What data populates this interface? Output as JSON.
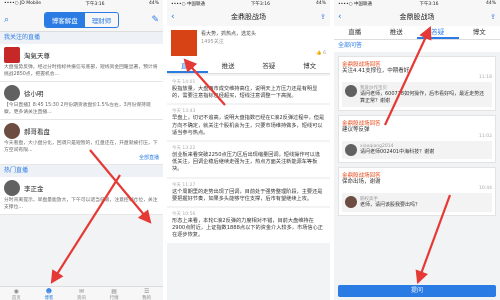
{
  "colors": {
    "accent": "#2a7be4",
    "arrow": "#e53935"
  },
  "p1": {
    "status_left": "••••○ JD Mobile",
    "status_time": "下午3:16",
    "status_right": "44%",
    "seg": [
      "博客解盘",
      "理财师"
    ],
    "section_live": "我关注的直播",
    "items": [
      {
        "name": "淘氣天尊",
        "time": "",
        "body": "大盘强势反弹，经过分时指标共振信号底部，短线资金回暖显著，预计将挑战2850点，把握机会..."
      },
      {
        "name": "徐小明",
        "time": "",
        "body": "【今日直播】8:45 15:30 2月份期货收盘价1.5%左右，3月份保持观察，更多请关注直播..."
      },
      {
        "name": "郝哥看盘",
        "time": "",
        "body": "今天看盘，大小盘分化，回调只是短暂的，红盘还在，开盘就被打压，下方空间有限..."
      }
    ],
    "more_link": "全部直播",
    "section_hot": "热门直播",
    "hot_item": {
      "name": "李正金",
      "body": "分时背离提示，早盘量能放大，下午可以适当低吸，注意控制仓位，关注支撑位..."
    },
    "tabs": [
      {
        "icon": "◉",
        "label": "首页"
      },
      {
        "icon": "☻",
        "label": "博客"
      },
      {
        "icon": "✉",
        "label": "资讯"
      },
      {
        "icon": "▤",
        "label": "行情"
      },
      {
        "icon": "☰",
        "label": "我的"
      }
    ]
  },
  "p2": {
    "status_left": "••••○ 中国联通",
    "status_time": "下午3:16",
    "status_right": "44%",
    "title": "金鼎股战场",
    "meta1": "看大势，抓热点，选龙头",
    "meta2": "1495关注",
    "likes": "👍 6",
    "tabs": [
      "直播",
      "推送",
      "答疑",
      "博文"
    ],
    "posts": [
      {
        "time": "今天 14:01",
        "body": "股指放量，大盘两市成交维持高位，说明天上方压力还是有明显的，需要注意指标已经超买，短线注意调整一下高抛。"
      },
      {
        "time": "今天 13:43",
        "body": "早盘上，切记不追高，说明大盘指数已经在C浪2反弹过程中，但是方向不确定，就关注个股机会为主，只要市场维持做多，短线可以适当参与热点。"
      },
      {
        "time": "今天 13:22",
        "body": "创业板来看突破2250点压力区后出现缩量回调，短线操作可以逢低关注，回调企稳后继续走强为主，热点方面关注新能源车等板块。"
      },
      {
        "time": "今天 11:27",
        "body": "这个周期里的走势出现了回调，目前处于强势整理阶段，主要还是要把握好节奏，如果多头能够守住支撑，后市有望继续上攻。"
      },
      {
        "time": "今天 10:56",
        "body": "形态上来看，本轮C浪2反弹的力度相对不错，目前大盘维持在2900点附近，上证指数1888点以下的资金介入较多，市场信心正在逐步恢复。"
      }
    ]
  },
  "p3": {
    "status_left": "••••○ 中国联通",
    "status_time": "下午3:16",
    "status_right": "44%",
    "title": "金鼎股战场",
    "tabs": [
      "直播",
      "推送",
      "答疑",
      "博文"
    ],
    "section": "全部问答",
    "qas": [
      {
        "user": "金鼎股战场回答",
        "q": "关注4.41支撑位，中期看好",
        "time": "11:18",
        "reply_name": "我爱炒作宝贝",
        "reply": "请问老师，600778如何操作，后市看好吗，最近走势还算正常？谢谢"
      },
      {
        "user": "金鼎股战场回答",
        "q": "建议等反弹",
        "time": "11:02",
        "reply_name": "xiaoqiang2014",
        "reply": "请问老师002401中海科技？谢谢"
      },
      {
        "user": "金鼎股战场回答",
        "q": "保命出场，谢谢",
        "time": "10:44",
        "reply_name": "期权高手",
        "reply": "老师，请问该股我要出吗？"
      }
    ],
    "ask_button": "提问"
  }
}
